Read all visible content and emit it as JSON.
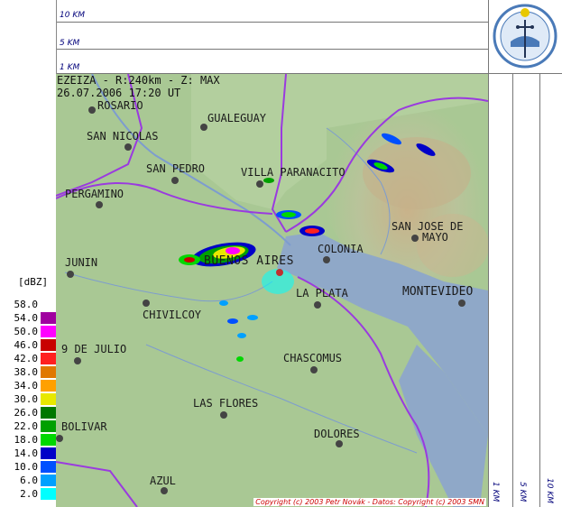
{
  "radar": {
    "title": "EZEIZA - R:240km - Z: MAX",
    "datetime": "26.07.2006 17:20 UT"
  },
  "top_panel": {
    "scale_labels": [
      "10 KM",
      "5 KM",
      "1 KM"
    ]
  },
  "right_panel": {
    "scale_labels": [
      "1 KM",
      "5 KM",
      "10 KM"
    ]
  },
  "legend": {
    "title": "[dBZ]",
    "items": [
      {
        "value": "58.0",
        "color": "#ffffff"
      },
      {
        "value": "54.0",
        "color": "#a000a0"
      },
      {
        "value": "50.0",
        "color": "#ff00ff"
      },
      {
        "value": "46.0",
        "color": "#c80000"
      },
      {
        "value": "42.0",
        "color": "#ff2020"
      },
      {
        "value": "38.0",
        "color": "#e07800"
      },
      {
        "value": "34.0",
        "color": "#ffa000"
      },
      {
        "value": "30.0",
        "color": "#e8e800"
      },
      {
        "value": "26.0",
        "color": "#007800"
      },
      {
        "value": "22.0",
        "color": "#00a000"
      },
      {
        "value": "18.0",
        "color": "#00d800"
      },
      {
        "value": "14.0",
        "color": "#0000c8"
      },
      {
        "value": "10.0",
        "color": "#0050ff"
      },
      {
        "value": "6.0",
        "color": "#00a0ff"
      },
      {
        "value": "2.0",
        "color": "#00ffff"
      }
    ]
  },
  "cities": [
    {
      "name": "ROSARIO"
    },
    {
      "name": "GUALEGUAY"
    },
    {
      "name": "SAN NICOLAS"
    },
    {
      "name": "SAN PEDRO"
    },
    {
      "name": "VILLA PARANACITO"
    },
    {
      "name": "PERGAMINO"
    },
    {
      "name": "SAN JOSE DE"
    },
    {
      "name": "MAYO"
    },
    {
      "name": "COLONIA"
    },
    {
      "name": "JUNIN"
    },
    {
      "name": "BUENOS AIRES"
    },
    {
      "name": "LA PLATA"
    },
    {
      "name": "MONTEVIDEO"
    },
    {
      "name": "CHIVILCOY"
    },
    {
      "name": "9 DE JULIO"
    },
    {
      "name": "CHASCOMUS"
    },
    {
      "name": "LAS FLORES"
    },
    {
      "name": "BOLIVAR"
    },
    {
      "name": "DOLORES"
    },
    {
      "name": "AZUL"
    }
  ],
  "copyright": "Copyright (c) 2003 Petr Novák - Datos: Copyright (c) 2003 SMN",
  "colors": {
    "land": "#a9c894",
    "water": "#8fa8c8",
    "border": "#9a3adf",
    "river": "#7d9ccf"
  }
}
